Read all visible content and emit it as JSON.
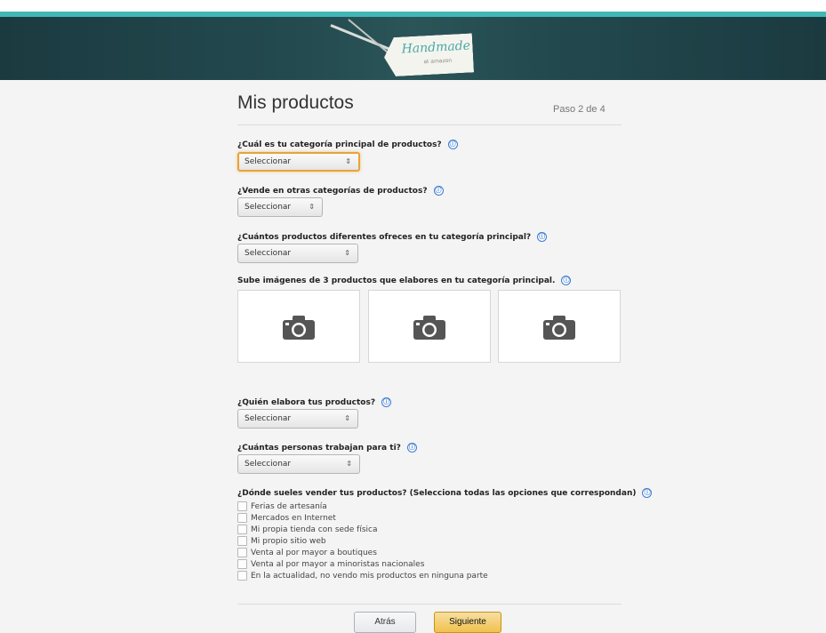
{
  "header": {
    "logo_title": "Handmade",
    "logo_sub": "at amazon"
  },
  "page": {
    "title": "Mis productos",
    "step": "Paso 2 de 4"
  },
  "questions": {
    "main_category": {
      "label": "¿Cuál es tu categoría principal de productos?",
      "value": "Seleccionar"
    },
    "other_categories": {
      "label": "¿Vende en otras categorías de productos?",
      "value": "Seleccionar"
    },
    "product_count": {
      "label": "¿Cuántos productos diferentes ofreces en tu categoría principal?",
      "value": "Seleccionar"
    },
    "images": {
      "label": "Sube imágenes de 3 productos que elabores en tu categoría principal."
    },
    "who_makes": {
      "label": "¿Quién elabora tus productos?",
      "value": "Seleccionar"
    },
    "employees": {
      "label": "¿Cuántas personas trabajan para ti?",
      "value": "Seleccionar"
    },
    "where_sell": {
      "label": "¿Dónde sueles vender tus productos? (Selecciona todas las opciones que correspondan)",
      "options": [
        "Ferias de artesanía",
        "Mercados en Internet",
        "Mi propia tienda con sede física",
        "Mi propio sitio web",
        "Venta al por mayor a boutiques",
        "Venta al por mayor a minoristas nacionales",
        "En la actualidad, no vendo mis productos en ninguna parte"
      ]
    }
  },
  "icons": {
    "info": "ⓘ",
    "select_arrow": "⇕",
    "camera": "camera-icon"
  },
  "buttons": {
    "back": "Atrás",
    "next": "Siguiente"
  },
  "colors": {
    "accent": "#43b7b5",
    "focus": "#e8a33b",
    "primary_button": "#f0c14b",
    "info": "#3b7bd1"
  }
}
